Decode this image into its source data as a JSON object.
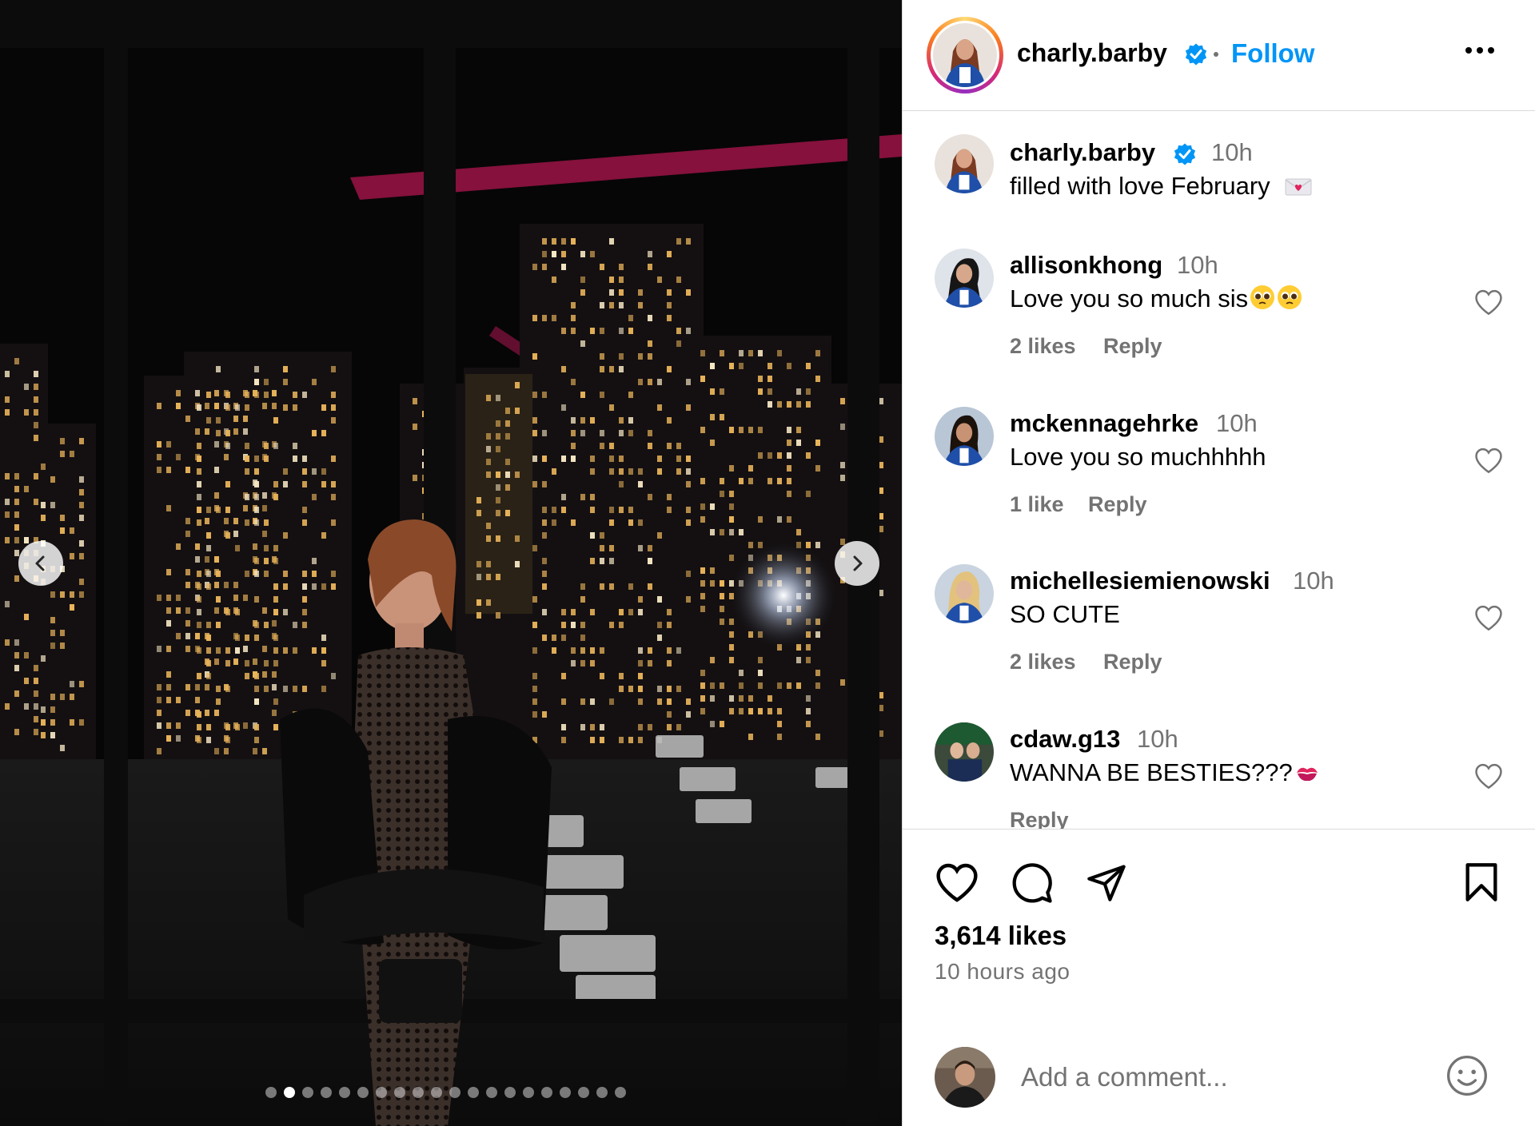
{
  "post": {
    "author": {
      "username": "charly.barby",
      "verified": true,
      "follow_label": "Follow"
    },
    "caption": {
      "username": "charly.barby",
      "time": "10h",
      "text": "filled with love February",
      "emoji": "love-letter"
    },
    "comments": [
      {
        "username": "allisonkhong",
        "time": "10h",
        "text": "Love you so much sis",
        "emoji": "pleading-face x2",
        "likes": "2 likes",
        "reply": "Reply"
      },
      {
        "username": "mckennagehrke",
        "time": "10h",
        "text": "Love you so muchhhhh",
        "likes": "1 like",
        "reply": "Reply"
      },
      {
        "username": "michellesiemienowski",
        "time": "10h",
        "text": "SO CUTE",
        "likes": "2 likes",
        "reply": "Reply"
      },
      {
        "username": "cdaw.g13",
        "time": "10h",
        "text": "WANNA BE BESTIES???",
        "emoji": "kiss-mark",
        "reply": "Reply"
      }
    ],
    "likes_count": "3,614 likes",
    "time_ago": "10 hours ago",
    "add_comment_placeholder": "Add a comment...",
    "carousel": {
      "total_slides": 20,
      "active_index": 1
    }
  },
  "icons": {
    "verified": "verified-badge-icon",
    "more": "more-options-icon",
    "prev": "chevron-left-icon",
    "next": "chevron-right-icon",
    "like": "heart-icon",
    "comment": "comment-bubble-icon",
    "share": "paper-plane-icon",
    "save": "bookmark-icon",
    "emoji": "smiley-icon"
  },
  "colors": {
    "accent": "#0095f6",
    "secondary_text": "#737373",
    "divider": "#dbdbdb",
    "verified_badge": "#0095f6"
  }
}
